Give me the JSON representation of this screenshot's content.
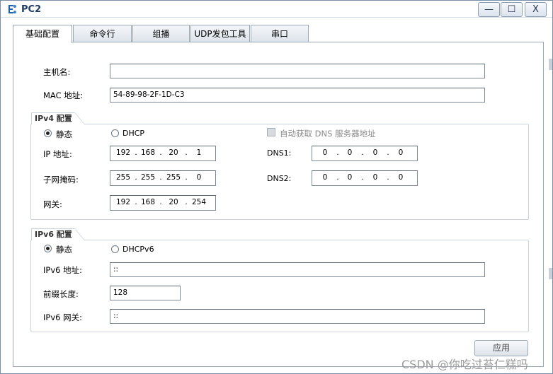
{
  "window": {
    "title": "PC2",
    "controls": {
      "minimize": "—",
      "maximize": "☐",
      "close": "X"
    }
  },
  "tabs": [
    {
      "label": "基础配置",
      "active": true
    },
    {
      "label": "命令行",
      "active": false
    },
    {
      "label": "组播",
      "active": false
    },
    {
      "label": "UDP发包工具",
      "active": false
    },
    {
      "label": "串口",
      "active": false
    }
  ],
  "basic": {
    "hostname_label": "主机名:",
    "hostname_value": "",
    "mac_label": "MAC 地址:",
    "mac_value": "54-89-98-2F-1D-C3"
  },
  "ipv4": {
    "group_title": "IPv4 配置",
    "static_label": "静态",
    "dhcp_label": "DHCP",
    "mode": "static",
    "auto_dns_label": "自动获取 DNS 服务器地址",
    "ip_label": "IP 地址:",
    "ip": [
      "192",
      "168",
      "20",
      "1"
    ],
    "mask_label": "子网掩码:",
    "mask": [
      "255",
      "255",
      "255",
      "0"
    ],
    "gateway_label": "网关:",
    "gateway": [
      "192",
      "168",
      "20",
      "254"
    ],
    "dns1_label": "DNS1:",
    "dns1": [
      "0",
      "0",
      "0",
      "0"
    ],
    "dns2_label": "DNS2:",
    "dns2": [
      "0",
      "0",
      "0",
      "0"
    ]
  },
  "ipv6": {
    "group_title": "IPv6 配置",
    "static_label": "静态",
    "dhcp_label": "DHCPv6",
    "mode": "static",
    "ip_label": "IPv6 地址:",
    "ip_value": "::",
    "prefix_label": "前缀长度:",
    "prefix_value": "128",
    "gateway_label": "IPv6 网关:",
    "gateway_value": "::"
  },
  "apply_label": "应用",
  "watermark": "CSDN @你吃过苔仁糕吗",
  "colors": {
    "title_text": "#1f3b66",
    "border": "#9aa7b7"
  }
}
